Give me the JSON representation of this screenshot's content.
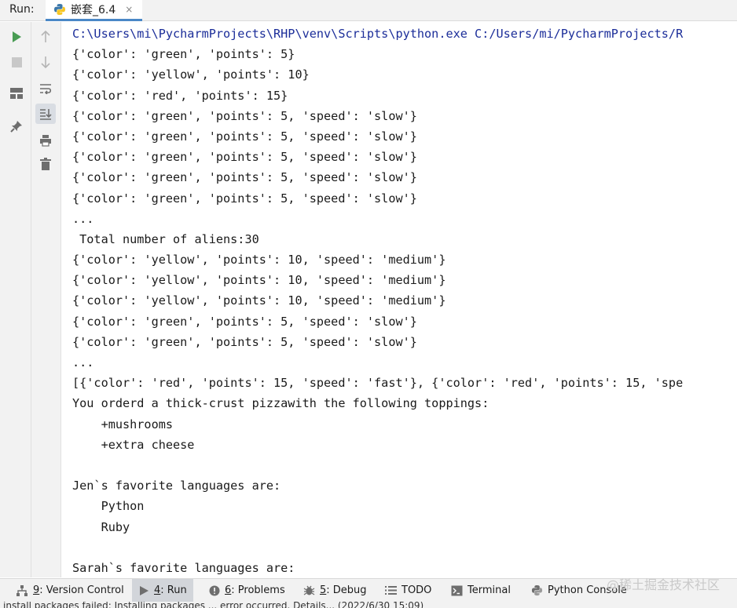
{
  "runbar": {
    "label": "Run:",
    "tab_title": "嵌套_6.4",
    "close": "×"
  },
  "toolbar": {
    "run": "run-icon",
    "stop": "stop-icon",
    "layout": "layout-icon",
    "pin": "pin-icon",
    "up": "arrow-up-icon",
    "down": "arrow-down-icon",
    "wrap": "soft-wrap-icon",
    "scroll_end": "scroll-to-end-icon",
    "print": "print-icon",
    "clear": "trash-icon"
  },
  "console": {
    "lines": [
      "C:\\Users\\mi\\PycharmProjects\\RHP\\venv\\Scripts\\python.exe C:/Users/mi/PycharmProjects/R",
      "{'color': 'green', 'points': 5}",
      "{'color': 'yellow', 'points': 10}",
      "{'color': 'red', 'points': 15}",
      "{'color': 'green', 'points': 5, 'speed': 'slow'}",
      "{'color': 'green', 'points': 5, 'speed': 'slow'}",
      "{'color': 'green', 'points': 5, 'speed': 'slow'}",
      "{'color': 'green', 'points': 5, 'speed': 'slow'}",
      "{'color': 'green', 'points': 5, 'speed': 'slow'}",
      "...",
      " Total number of aliens:30",
      "{'color': 'yellow', 'points': 10, 'speed': 'medium'}",
      "{'color': 'yellow', 'points': 10, 'speed': 'medium'}",
      "{'color': 'yellow', 'points': 10, 'speed': 'medium'}",
      "{'color': 'green', 'points': 5, 'speed': 'slow'}",
      "{'color': 'green', 'points': 5, 'speed': 'slow'}",
      "...",
      "[{'color': 'red', 'points': 15, 'speed': 'fast'}, {'color': 'red', 'points': 15, 'spe",
      "You orderd a thick-crust pizzawith the following toppings:",
      "    +mushrooms",
      "    +extra cheese",
      "",
      "Jen`s favorite languages are:",
      "    Python",
      "    Ruby",
      "",
      "Sarah`s favorite languages are:"
    ]
  },
  "bottombar": {
    "tabs": [
      {
        "mnemonic": "9",
        "label": ": Version Control",
        "icon": "version-control-icon"
      },
      {
        "mnemonic": "4",
        "label": ": Run",
        "icon": "run-tab-icon"
      },
      {
        "mnemonic": "6",
        "label": ": Problems",
        "icon": "problems-icon"
      },
      {
        "mnemonic": "5",
        "label": ": Debug",
        "icon": "debug-icon"
      },
      {
        "mnemonic": "",
        "label": "TODO",
        "icon": "todo-icon"
      },
      {
        "mnemonic": "",
        "label": "Terminal",
        "icon": "terminal-icon"
      },
      {
        "mnemonic": "",
        "label": "Python Console",
        "icon": "python-console-icon"
      }
    ]
  },
  "watermark": "@稀土掘金技术社区",
  "statusbar": {
    "text": "install packages failed: Installing packages ... error occurred. Details... (2022/6/30 15:09)"
  },
  "colors": {
    "accent": "#4a88c7",
    "run_green": "#499c54",
    "cmd_blue": "#1b2d99"
  }
}
